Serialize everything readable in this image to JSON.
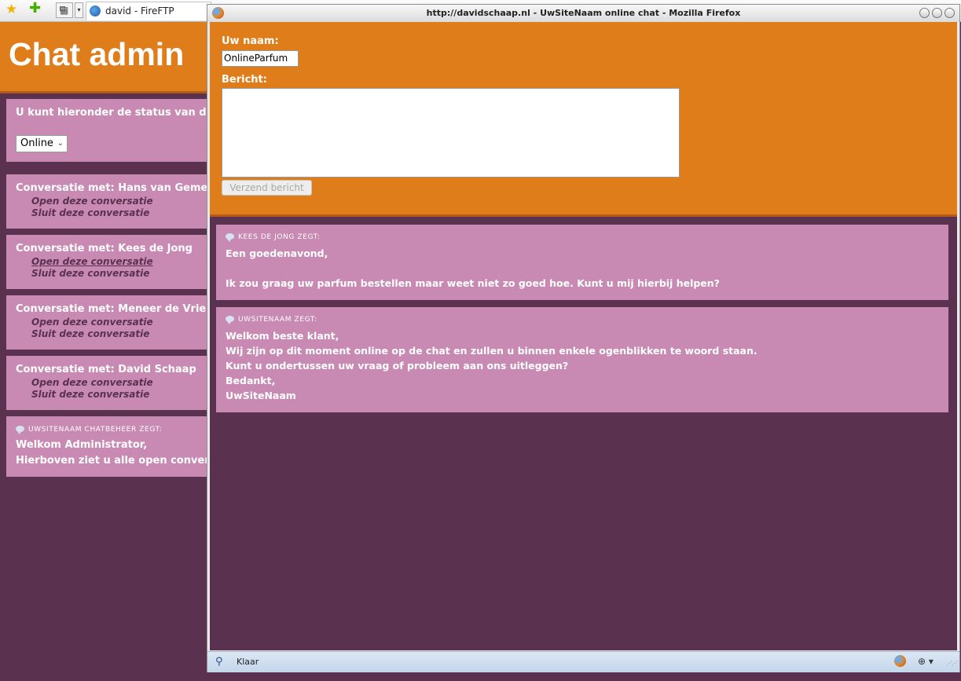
{
  "background_window": {
    "toolbar": {
      "tab_label": "david - FireFTP"
    },
    "header": {
      "title": "Chat admin"
    },
    "status_box": {
      "text": "U kunt hieronder de status van de chat",
      "status_value": "Online"
    },
    "conversations": [
      {
        "title": "Conversatie met: Hans van Gemert",
        "open_label": "Open deze conversatie",
        "close_label": "Sluit deze conversatie"
      },
      {
        "title": "Conversatie met: Kees de Jong",
        "open_label": "Open deze conversatie",
        "close_label": "Sluit deze conversatie"
      },
      {
        "title": "Conversatie met: Meneer de Vries",
        "open_label": "Open deze conversatie",
        "close_label": "Sluit deze conversatie"
      },
      {
        "title": "Conversatie met: David Schaap",
        "open_label": "Open deze conversatie",
        "close_label": "Sluit deze conversatie"
      }
    ],
    "admin_message": {
      "sender": "UWSITENAAM CHATBEHEER ZEGT:",
      "lines": [
        "Welkom Administrator,",
        "Hierboven ziet u alle open conversatie"
      ]
    }
  },
  "popup": {
    "title": "http://davidschaap.nl - UwSiteNaam online chat - Mozilla Firefox",
    "form": {
      "name_label": "Uw naam:",
      "name_value": "OnlineParfum",
      "message_label": "Bericht:",
      "message_value": "",
      "send_label": "Verzend bericht"
    },
    "messages": [
      {
        "sender": "KEES DE JONG ZEGT:",
        "lines": [
          "Een goedenavond,",
          "",
          "Ik zou graag uw parfum bestellen maar weet niet zo goed hoe. Kunt u mij hierbij helpen?"
        ]
      },
      {
        "sender": "UWSITENAAM ZEGT:",
        "lines": [
          "Welkom beste klant,",
          "Wij zijn op dit moment online op de chat en zullen u binnen enkele ogenblikken te woord staan.",
          "Kunt u ondertussen uw vraag of probleem aan ons uitleggen?",
          "Bedankt,",
          "UwSiteNaam"
        ]
      }
    ],
    "statusbar": {
      "text": "Klaar"
    }
  }
}
